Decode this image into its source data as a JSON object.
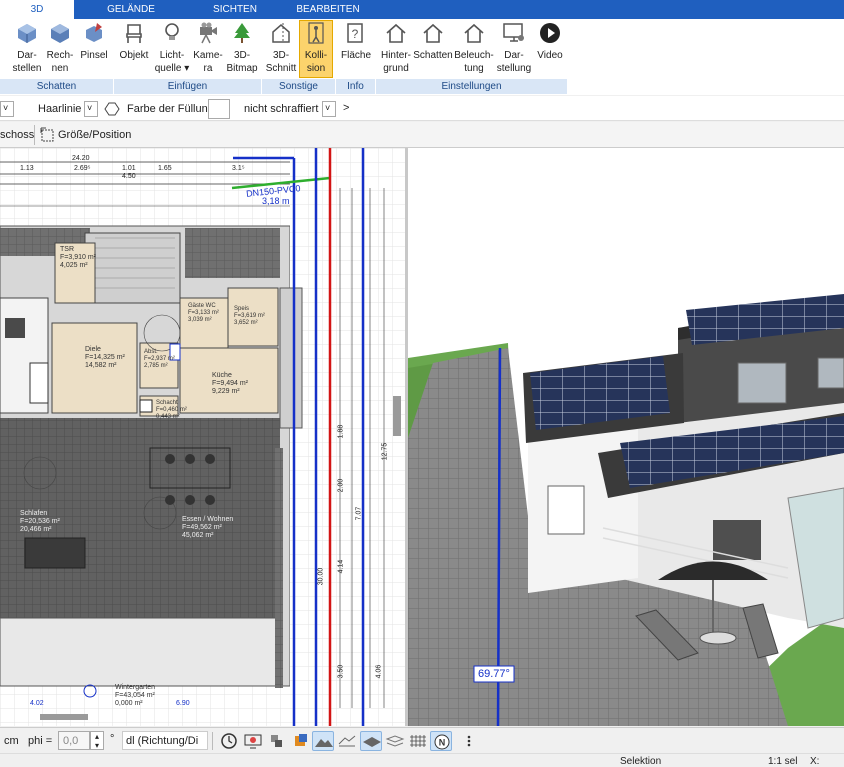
{
  "tabs": [
    {
      "label": "3D"
    },
    {
      "label": "GELÄNDE"
    },
    {
      "label": "SICHTEN"
    },
    {
      "label": "BEARBEITEN"
    }
  ],
  "ribbon": {
    "buttons": [
      {
        "label": "Dar-\nstellen"
      },
      {
        "label": "Rech-\nnen"
      },
      {
        "label": "Pinsel"
      },
      {
        "label": "Objekt"
      },
      {
        "label": "Licht-\nquelle ▾"
      },
      {
        "label": "Kame-\nra"
      },
      {
        "label": "3D-\nBitmap"
      },
      {
        "label": "3D-\nSchnitt"
      },
      {
        "label": "Kolli-\nsion"
      },
      {
        "label": "Fläche"
      },
      {
        "label": "Hinter-\ngrund"
      },
      {
        "label": "Schatten"
      },
      {
        "label": "Beleuch-\ntung"
      },
      {
        "label": "Dar-\nstellung"
      },
      {
        "label": "Video"
      }
    ],
    "groups": [
      {
        "label": "Schatten"
      },
      {
        "label": "Einfügen"
      },
      {
        "label": "Sonstige"
      },
      {
        "label": "Info"
      },
      {
        "label": "Einstellungen"
      }
    ]
  },
  "optbar": {
    "line_type": "Haarlinie",
    "fill_label": "Farbe der Füllung",
    "hatch": "nicht schraffiert",
    "arrow": ">"
  },
  "toolbar2": {
    "floor": "schoss",
    "size_position": "Größe/Position"
  },
  "plan": {
    "dims_top": [
      "1.13",
      "2.69⁵",
      "24.20",
      "1.01",
      "4.50",
      "1.65",
      "3.1⁵"
    ],
    "pipe_label": "DN150-PVC0",
    "pipe_length": "3,18 m",
    "rooms": [
      {
        "name": "Diele",
        "area": "F=14,325 m²",
        "net": "14,582 m²"
      },
      {
        "name": "Küche",
        "area": "F=9,494 m²",
        "net": "9,229 m²"
      },
      {
        "name": "Gäste WC",
        "area": "F=3,133 m²",
        "net": "3,039 m²"
      },
      {
        "name": "Speis",
        "area": "F=3,619 m²",
        "net": "3,652 m²"
      },
      {
        "name": "Abst.",
        "area": "F=2,937 m²",
        "net": "2,785 m²"
      },
      {
        "name": "Schacht",
        "area": "F=0,460 m²",
        "net": "0,443 m²"
      },
      {
        "name": "TSR",
        "area": "F=3,910 m²",
        "net": "4,025 m²"
      },
      {
        "name": "Schlafen",
        "area": "F=20,536 m²",
        "net": "20,466 m²"
      },
      {
        "name": "Essen / Wohnen",
        "area": "F=49,562 m²",
        "net": "45,062 m²"
      },
      {
        "name": "Wintergarten",
        "area": "F=43,054 m²",
        "net": "0,000 m²"
      }
    ],
    "vert_dims": [
      "12.75",
      "30.00",
      "7.07",
      "2.00",
      "1.88",
      "4.14",
      "3.50",
      "4.06"
    ],
    "bottom_dims": [
      "4.02",
      "6.90"
    ]
  },
  "view3d": {
    "angle_label": "69.77°"
  },
  "bottombar": {
    "unit": "cm",
    "phi_label": "phi =",
    "phi_value": "0,0",
    "degree": "°",
    "direction": "dl (Richtung/Di"
  },
  "status": {
    "mode": "Selektion",
    "scale": "1:1 sel",
    "x_label": "X:"
  },
  "colors": {
    "tab_bar": "#1f5fbf",
    "group_bar": "#d9e6f6",
    "selected_button": "#fcd36c",
    "grass": "#6aa84f",
    "panel": "#26345a",
    "pipe_blue": "#1530c8",
    "pipe_red": "#d21414"
  }
}
